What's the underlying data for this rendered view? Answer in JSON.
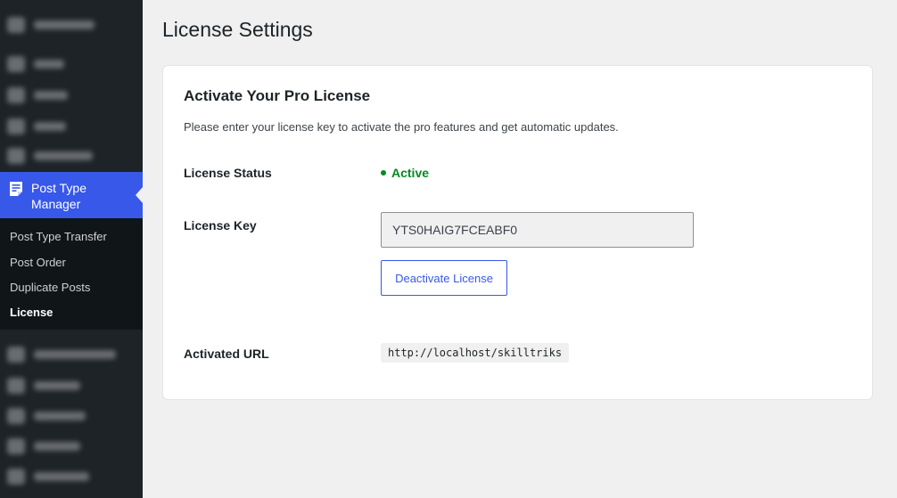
{
  "sidebar": {
    "active_menu_label": "Post Type Manager",
    "submenu": [
      {
        "label": "Post Type Transfer",
        "current": false
      },
      {
        "label": "Post Order",
        "current": false
      },
      {
        "label": "Duplicate Posts",
        "current": false
      },
      {
        "label": "License",
        "current": true
      }
    ]
  },
  "page": {
    "title": "License Settings"
  },
  "card": {
    "heading": "Activate Your Pro License",
    "description": "Please enter your license key to activate the pro features and get automatic updates.",
    "status_label": "License Status",
    "status_value": "Active",
    "key_label": "License Key",
    "key_value": "YTS0HAIG7FCEABF0",
    "deactivate_label": "Deactivate License",
    "url_label": "Activated URL",
    "url_value": "http://localhost/skilltriks"
  },
  "colors": {
    "accent": "#3858e9",
    "status_active": "#008a20",
    "sidebar_bg": "#1d2327"
  }
}
